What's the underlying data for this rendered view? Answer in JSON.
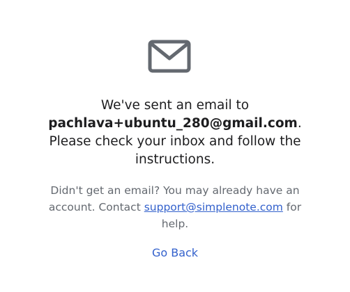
{
  "icon": "mail-icon",
  "colors": {
    "icon": "#646970",
    "text": "#1d1d1f",
    "muted_text": "#646970",
    "link": "#3361cc"
  },
  "message": {
    "prefix": "We've sent an email to",
    "email": "pachlava+ubuntu_280@gmail.com",
    "suffix": ". Please check your inbox and follow the instructions."
  },
  "help": {
    "prefix": "Didn't get an email? You may already have an account. Contact",
    "support_email": "support@simplenote.com",
    "suffix": "for help."
  },
  "go_back_label": "Go Back"
}
